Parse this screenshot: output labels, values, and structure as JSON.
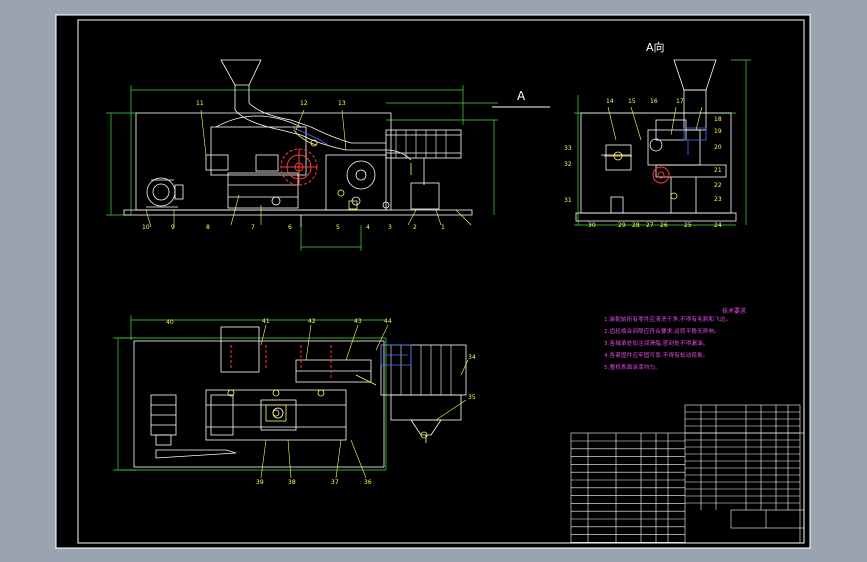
{
  "view_labels": {
    "section_a": "A",
    "view_a": "A向"
  },
  "tech_notes": {
    "title": "技术要求",
    "lines": [
      "1.装配前所有零件应清洗干净,不得有毛刺和飞边。",
      "2.齿轮啮合间隙应符合要求,运转平稳无异响。",
      "3.各轴承处加注润滑脂,密封处不得漏油。",
      "4.各紧固件应牢固可靠,不得有松动现象。",
      "5.整机表面涂漆均匀。"
    ]
  },
  "part_numbers": {
    "front": [
      "11",
      "12",
      "13",
      "10",
      "9",
      "8",
      "7",
      "6",
      "5",
      "4",
      "3",
      "2",
      "1"
    ],
    "side": [
      "14",
      "15",
      "16",
      "17",
      "18",
      "19",
      "20",
      "21",
      "22",
      "23",
      "24",
      "25",
      "26",
      "27",
      "28",
      "29",
      "30",
      "31",
      "32",
      "33"
    ],
    "plan": [
      "40",
      "41",
      "42",
      "43",
      "44",
      "34",
      "35",
      "39",
      "38",
      "37",
      "36"
    ]
  },
  "colors": {
    "background": "#9aa4b1",
    "sheet": "#000000",
    "outline": "#ffffff",
    "dimension": "#3fe03f",
    "part": "#ffffff",
    "label": "#ffff55",
    "gear": "#ff3a3a",
    "hidden": "#4a6dff",
    "notes": "#e84ce8"
  }
}
